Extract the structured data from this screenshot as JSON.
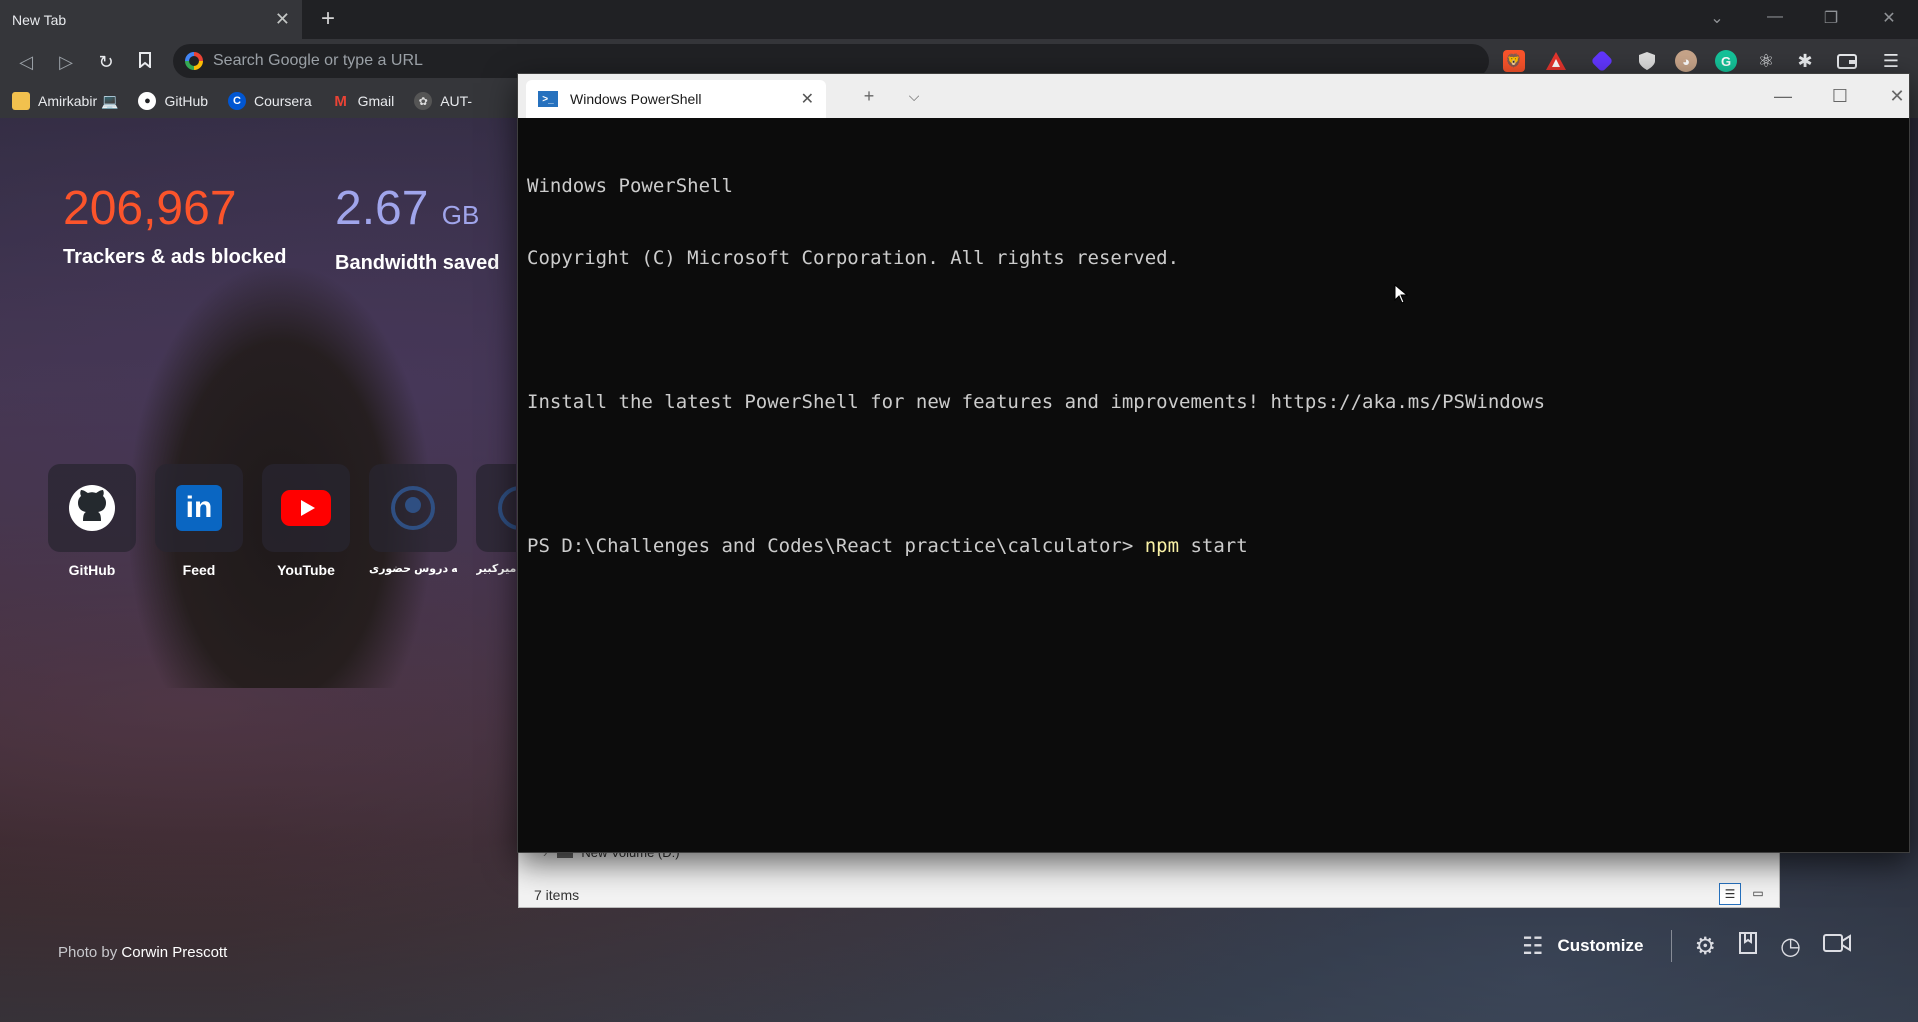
{
  "browser": {
    "tab_title": "New Tab",
    "tab_close": "✕",
    "new_tab": "+",
    "omnibox_placeholder": "Search Google or type a URL",
    "bookmarks": [
      {
        "label": "Amirkabir 💻",
        "icon": "folder-icon"
      },
      {
        "label": "GitHub",
        "icon": "github-icon"
      },
      {
        "label": "Coursera",
        "icon": "coursera-icon"
      },
      {
        "label": "Gmail",
        "icon": "gmail-icon"
      },
      {
        "label": "AUT-",
        "icon": "aut-icon"
      }
    ]
  },
  "ntp": {
    "trackers_count": "206,967",
    "trackers_label": "Trackers & ads blocked",
    "bandwidth_value": "2.67",
    "bandwidth_unit": "GB",
    "bandwidth_label": "Bandwidth saved",
    "tiles": [
      {
        "label": "GitHub",
        "icon": "github-icon"
      },
      {
        "label": "Feed",
        "icon": "linkedin-icon"
      },
      {
        "label": "YouTube",
        "icon": "youtube-icon"
      },
      {
        "label": "ـه دروس حضوری",
        "icon": "site-icon"
      },
      {
        "label": "امیرکبیر",
        "icon": "site-icon"
      }
    ],
    "photo_prefix": "Photo by",
    "photo_author": "Corwin Prescott",
    "customize_label": "Customize",
    "colors": {
      "trackers": "#fb542b",
      "bandwidth": "#a0a5eb"
    }
  },
  "explorer": {
    "tree_item": "New Volume (D:)",
    "status": "7 items"
  },
  "powershell": {
    "tab_title": "Windows PowerShell",
    "lines": [
      "Windows PowerShell",
      "Copyright (C) Microsoft Corporation. All rights reserved.",
      "",
      "Install the latest PowerShell for new features and improvements! https://aka.ms/PSWindows",
      ""
    ],
    "prompt": "PS D:\\Challenges and Codes\\React practice\\calculator> ",
    "command": "npm",
    "command_args": " start"
  }
}
